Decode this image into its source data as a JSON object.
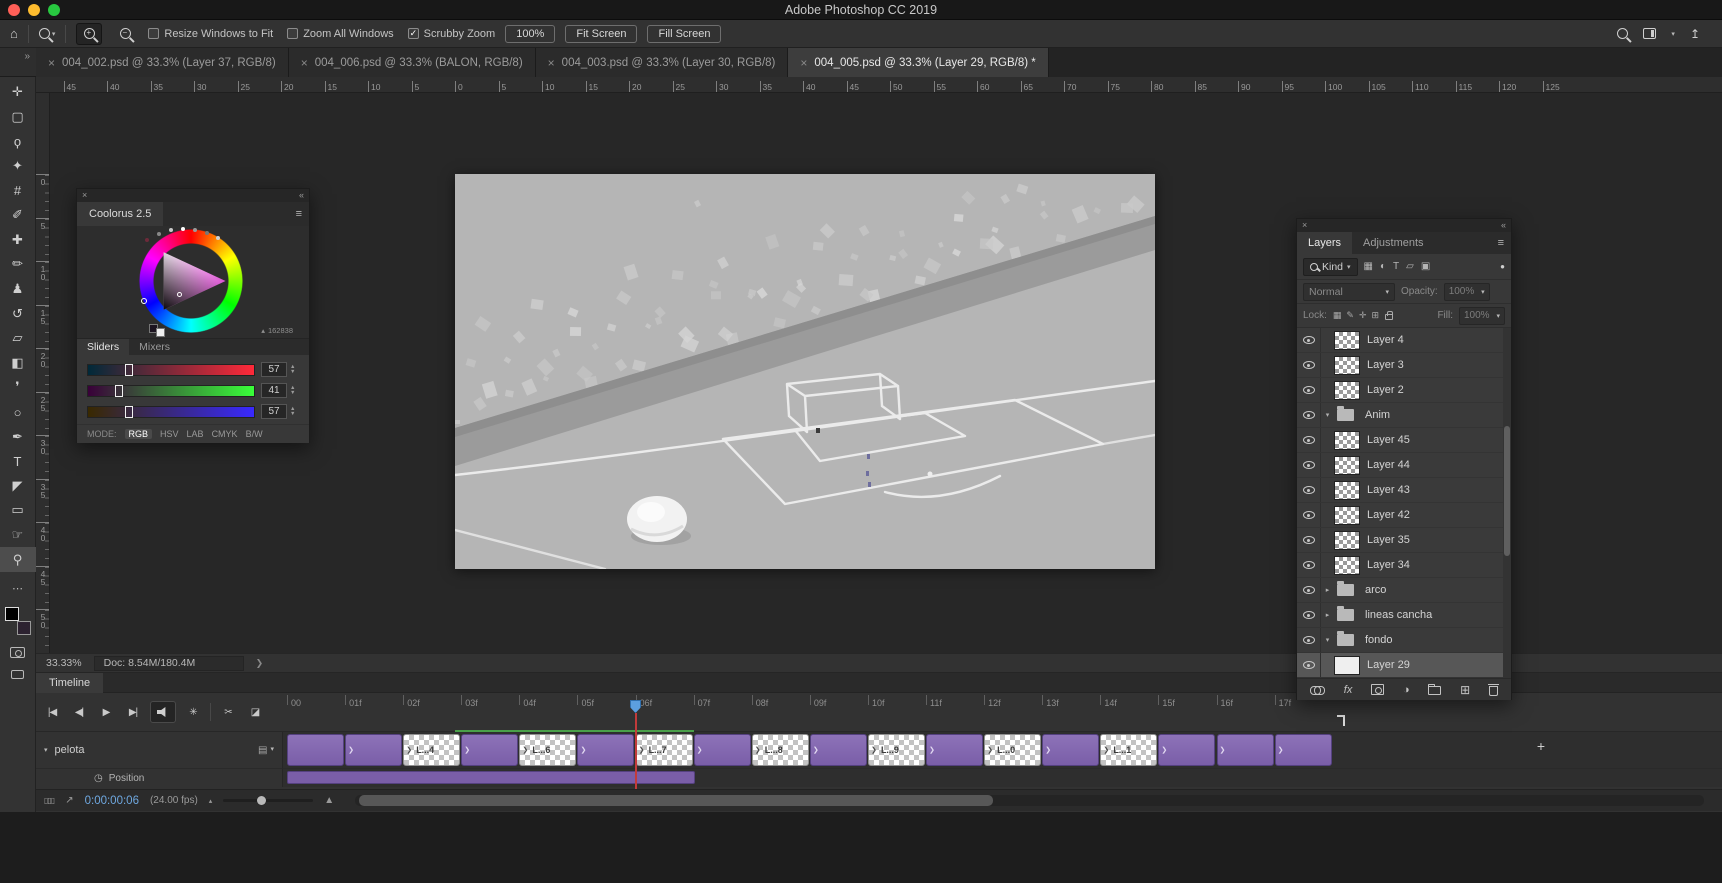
{
  "window": {
    "title": "Adobe Photoshop CC 2019"
  },
  "icons": {
    "home": "⌂",
    "caret_down": "▾",
    "plus_sign": "+",
    "minus_sign": "−",
    "close": "×",
    "collapse_right": "»",
    "collapse_left": "«",
    "menu": "≡",
    "chevron_right": "❯",
    "ellipsis": "⋯",
    "spin_up": "▲",
    "spin_down": "▼",
    "share": "↥",
    "dot": "●",
    "frames": "▯▯▯",
    "flyout": "↗",
    "zoom_small": "▴",
    "zoom_large": "▲",
    "stopwatch": "◷",
    "film": "▤",
    "adjustment_half": "◑",
    "new_layer": "⊞",
    "add": "+"
  },
  "options_bar": {
    "checkboxes": [
      {
        "label": "Resize Windows to Fit",
        "state": ""
      },
      {
        "label": "Zoom All Windows",
        "state": ""
      },
      {
        "label": "Scrubby Zoom",
        "state": "checked"
      }
    ],
    "zoom_value": "100%",
    "fit_screen": "Fit Screen",
    "fill_screen": "Fill Screen"
  },
  "tabs": [
    {
      "label": "004_002.psd @ 33.3% (Layer 37, RGB/8)",
      "state": ""
    },
    {
      "label": "004_006.psd @ 33.3% (BALON, RGB/8)",
      "state": ""
    },
    {
      "label": "004_003.psd @ 33.3% (Layer 30, RGB/8)",
      "state": ""
    },
    {
      "label": "004_005.psd @ 33.3% (Layer 29, RGB/8) *",
      "state": "active"
    }
  ],
  "ruler_h": [
    "45",
    "40",
    "35",
    "30",
    "25",
    "20",
    "15",
    "10",
    "5",
    "0",
    "5",
    "10",
    "15",
    "20",
    "25",
    "30",
    "35",
    "40",
    "45",
    "50",
    "55",
    "60",
    "65",
    "70",
    "75",
    "80",
    "85",
    "90",
    "95",
    "100",
    "105",
    "110",
    "115",
    "120",
    "125"
  ],
  "ruler_v": [
    "0",
    "5",
    "10",
    "15",
    "20",
    "25",
    "30",
    "35",
    "40",
    "45",
    "50",
    "55"
  ],
  "tools": [
    {
      "name": "move-tool",
      "glyph": "✛",
      "state": ""
    },
    {
      "name": "rectangular-marquee-tool",
      "glyph": "▢",
      "state": ""
    },
    {
      "name": "lasso-tool",
      "glyph": "ϙ",
      "state": ""
    },
    {
      "name": "quick-selection-tool",
      "glyph": "✦",
      "state": ""
    },
    {
      "name": "crop-tool",
      "glyph": "#",
      "state": ""
    },
    {
      "name": "eyedropper-tool",
      "glyph": "✐",
      "state": ""
    },
    {
      "name": "spot-healing-brush-tool",
      "glyph": "✚",
      "state": ""
    },
    {
      "name": "brush-tool",
      "glyph": "✏",
      "state": ""
    },
    {
      "name": "clone-stamp-tool",
      "glyph": "♟",
      "state": ""
    },
    {
      "name": "history-brush-tool",
      "glyph": "↺",
      "state": ""
    },
    {
      "name": "eraser-tool",
      "glyph": "▱",
      "state": ""
    },
    {
      "name": "gradient-tool",
      "glyph": "◧",
      "state": ""
    },
    {
      "name": "blur-tool",
      "glyph": "❜",
      "state": ""
    },
    {
      "name": "dodge-tool",
      "glyph": "○",
      "state": ""
    },
    {
      "name": "pen-tool",
      "glyph": "✒",
      "state": ""
    },
    {
      "name": "type-tool",
      "glyph": "T",
      "state": ""
    },
    {
      "name": "path-selection-tool",
      "glyph": "◤",
      "state": ""
    },
    {
      "name": "rectangle-tool",
      "glyph": "▭",
      "state": ""
    },
    {
      "name": "hand-tool",
      "glyph": "☞",
      "state": ""
    },
    {
      "name": "zoom-tool",
      "glyph": "⚲",
      "state": "active"
    }
  ],
  "status": {
    "zoom": "33.33%",
    "doc": "Doc: 8.54M/180.4M"
  },
  "coolorus": {
    "title": "Coolorus 2.5",
    "tabs": [
      {
        "label": "Sliders",
        "state": "active"
      },
      {
        "label": "Mixers",
        "state": ""
      }
    ],
    "hex": "162838",
    "sliders": [
      {
        "channel": "r",
        "value": "57",
        "pos": "22%"
      },
      {
        "channel": "g",
        "value": "41",
        "pos": "16%"
      },
      {
        "channel": "b",
        "value": "57",
        "pos": "22%"
      }
    ],
    "mode_label": "MODE:",
    "modes": [
      {
        "label": "RGB",
        "state": "active"
      },
      {
        "label": "HSV",
        "state": ""
      },
      {
        "label": "LAB",
        "state": ""
      },
      {
        "label": "CMYK",
        "state": ""
      },
      {
        "label": "B/W",
        "state": ""
      }
    ]
  },
  "layers_panel": {
    "tabs": [
      {
        "label": "Layers",
        "state": "active"
      },
      {
        "label": "Adjustments",
        "state": ""
      }
    ],
    "kind": "Kind",
    "filter_icons": [
      {
        "name": "filter-pixel-layers-icon",
        "glyph": "▦"
      },
      {
        "name": "filter-adjustment-layers-icon",
        "glyph": "◐"
      },
      {
        "name": "filter-type-layers-icon",
        "glyph": "T"
      },
      {
        "name": "filter-shape-layers-icon",
        "glyph": "▱"
      },
      {
        "name": "filter-smart-objects-icon",
        "glyph": "▣"
      }
    ],
    "blend_mode": "Normal",
    "opacity_label": "Opacity:",
    "opacity_value": "100%",
    "lock_label": "Lock:",
    "lock_icons": [
      {
        "name": "lock-transparent-pixels-icon",
        "glyph": "▦"
      },
      {
        "name": "lock-image-pixels-icon",
        "glyph": "✎"
      },
      {
        "name": "lock-position-icon",
        "glyph": "✛"
      },
      {
        "name": "lock-artboard-icon",
        "glyph": "⊞"
      }
    ],
    "fill_label": "Fill:",
    "fill_value": "100%",
    "rows": [
      {
        "name": "Layer 4",
        "chev": "",
        "thumb": "checker",
        "state": ""
      },
      {
        "name": "Layer 3",
        "chev": "",
        "thumb": "checker",
        "state": ""
      },
      {
        "name": "Layer 2",
        "chev": "",
        "thumb": "checker",
        "state": ""
      },
      {
        "name": "Anim",
        "chev": "▾",
        "thumb": "folder",
        "state": ""
      },
      {
        "name": "Layer 45",
        "chev": "",
        "thumb": "checker",
        "state": ""
      },
      {
        "name": "Layer 44",
        "chev": "",
        "thumb": "checker",
        "state": ""
      },
      {
        "name": "Layer 43",
        "chev": "",
        "thumb": "checker",
        "state": ""
      },
      {
        "name": "Layer 42",
        "chev": "",
        "thumb": "checker",
        "state": ""
      },
      {
        "name": "Layer 35",
        "chev": "",
        "thumb": "checker",
        "state": ""
      },
      {
        "name": "Layer 34",
        "chev": "",
        "thumb": "checker",
        "state": ""
      },
      {
        "name": "arco",
        "chev": "▸",
        "thumb": "folder",
        "state": ""
      },
      {
        "name": "lineas cancha",
        "chev": "▸",
        "thumb": "folder",
        "state": ""
      },
      {
        "name": "fondo",
        "chev": "▾",
        "thumb": "folder",
        "state": ""
      },
      {
        "name": "Layer 29",
        "chev": "",
        "thumb": "white",
        "state": "selected"
      }
    ],
    "fx_label": "fx"
  },
  "timeline": {
    "tab": "Timeline",
    "transport": [
      {
        "name": "go-to-first-frame-button",
        "glyph": "|◀"
      },
      {
        "name": "previous-frame-button",
        "glyph": "◀|"
      },
      {
        "name": "play-button",
        "glyph": "▶"
      },
      {
        "name": "next-frame-button",
        "glyph": "▶|"
      }
    ],
    "settings_glyph": "✳",
    "split_glyph": "✂",
    "transition_glyph": "◪",
    "ruler": [
      "00",
      "01f",
      "02f",
      "03f",
      "04f",
      "05f",
      "06f",
      "07f",
      "08f",
      "09f",
      "10f",
      "11f",
      "12f",
      "13f",
      "14f",
      "15f",
      "16f",
      "17f"
    ],
    "track_name": "pelota",
    "clips": [
      {
        "kind": "purple",
        "label": "",
        "chev": ""
      },
      {
        "kind": "purple",
        "label": "",
        "chev": "❯"
      },
      {
        "kind": "alpha",
        "label": "L...4",
        "chev": "❯"
      },
      {
        "kind": "purple",
        "label": "",
        "chev": "❯"
      },
      {
        "kind": "alpha",
        "label": "L...6",
        "chev": "❯"
      },
      {
        "kind": "purple",
        "label": "",
        "chev": "❯"
      },
      {
        "kind": "alpha",
        "label": "L...7",
        "chev": "❯"
      },
      {
        "kind": "purple",
        "label": "",
        "chev": "❯"
      },
      {
        "kind": "alpha",
        "label": "L...8",
        "chev": "❯"
      },
      {
        "kind": "purple",
        "label": "",
        "chev": "❯"
      },
      {
        "kind": "alpha",
        "label": "L...9",
        "chev": "❯"
      },
      {
        "kind": "purple",
        "label": "",
        "chev": "❯"
      },
      {
        "kind": "alpha",
        "label": "L...0",
        "chev": "❯"
      },
      {
        "kind": "purple",
        "label": "",
        "chev": "❯"
      },
      {
        "kind": "alpha",
        "label": "L...1",
        "chev": "❯"
      },
      {
        "kind": "purple",
        "label": "",
        "chev": "❯"
      },
      {
        "kind": "purple",
        "label": "",
        "chev": "❯"
      },
      {
        "kind": "purple",
        "label": "",
        "chev": "❯"
      }
    ],
    "property_label": "Position",
    "timecode": "0:00:00:06",
    "fps": "(24.00 fps)"
  }
}
